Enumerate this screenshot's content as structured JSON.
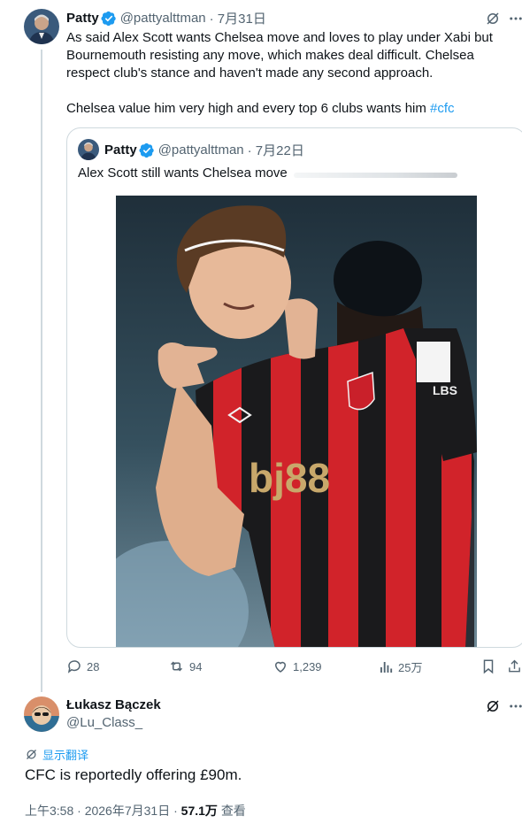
{
  "main_tweet": {
    "name": "Patty",
    "handle": "@pattyalttman",
    "date": "· 7月31日",
    "text_line1": "As said Alex Scott wants Chelsea move and loves to play under Xabi but",
    "text_line2": "Bournemouth resisting any move, which makes deal difficult. Chelsea",
    "text_line3": "respect club's stance and haven't made any second approach.",
    "text_line4": "Chelsea value him very high and every top 6 clubs wants him ",
    "hashtag": "#cfc",
    "stats": {
      "replies": "28",
      "reposts": "94",
      "likes": "1,239",
      "views": "25万"
    }
  },
  "quoted_tweet": {
    "name": "Patty",
    "handle": "@pattyalttman",
    "date": "· 7月22日",
    "text": "Alex Scott still wants Chelsea move",
    "photo_shirt_sponsor": "bj88",
    "photo_sleeve_badge": "LBS"
  },
  "reply_tweet": {
    "name": "Łukasz Bączek",
    "handle": "@Lu_Class_",
    "translate_label": "显示翻译",
    "text": "CFC is reportedly offering £90m.",
    "time": "上午3:58",
    "date": "2026年7月31日",
    "views": "57.1万",
    "views_label": "查看"
  },
  "colors": {
    "accent": "#1d9bf0",
    "secondary_text": "#536471",
    "border": "#cfd9de"
  },
  "icons": [
    "verified-badge-icon",
    "grok-icon",
    "more-icon",
    "reply-icon",
    "repost-icon",
    "like-icon",
    "views-icon",
    "bookmark-icon",
    "share-icon",
    "translate-icon"
  ]
}
